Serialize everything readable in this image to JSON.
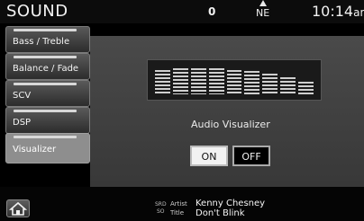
{
  "header": {
    "title": "SOUND",
    "channel": "0",
    "compass": "NE",
    "clock": "10:14",
    "clock_suffix": "ar"
  },
  "nav": {
    "items": [
      {
        "label": "Bass / Treble",
        "active": false
      },
      {
        "label": "Balance / Fade",
        "active": false
      },
      {
        "label": "SCV",
        "active": false
      },
      {
        "label": "DSP",
        "active": false
      },
      {
        "label": "Visualizer",
        "active": true
      }
    ]
  },
  "visualizer": {
    "title": "Audio Visualizer",
    "levels": [
      0.85,
      0.9,
      0.92,
      0.9,
      0.85,
      0.8,
      0.72,
      0.58,
      0.45
    ],
    "on_label": "ON",
    "off_label": "OFF",
    "selected": "ON"
  },
  "now_playing": {
    "source_top": "SRD",
    "source_bottom": "SO",
    "artist_key": "Artist",
    "artist": "Kenny Chesney",
    "title_key": "Title",
    "title": "Don't Blink"
  },
  "icons": {
    "home": "home-icon"
  }
}
